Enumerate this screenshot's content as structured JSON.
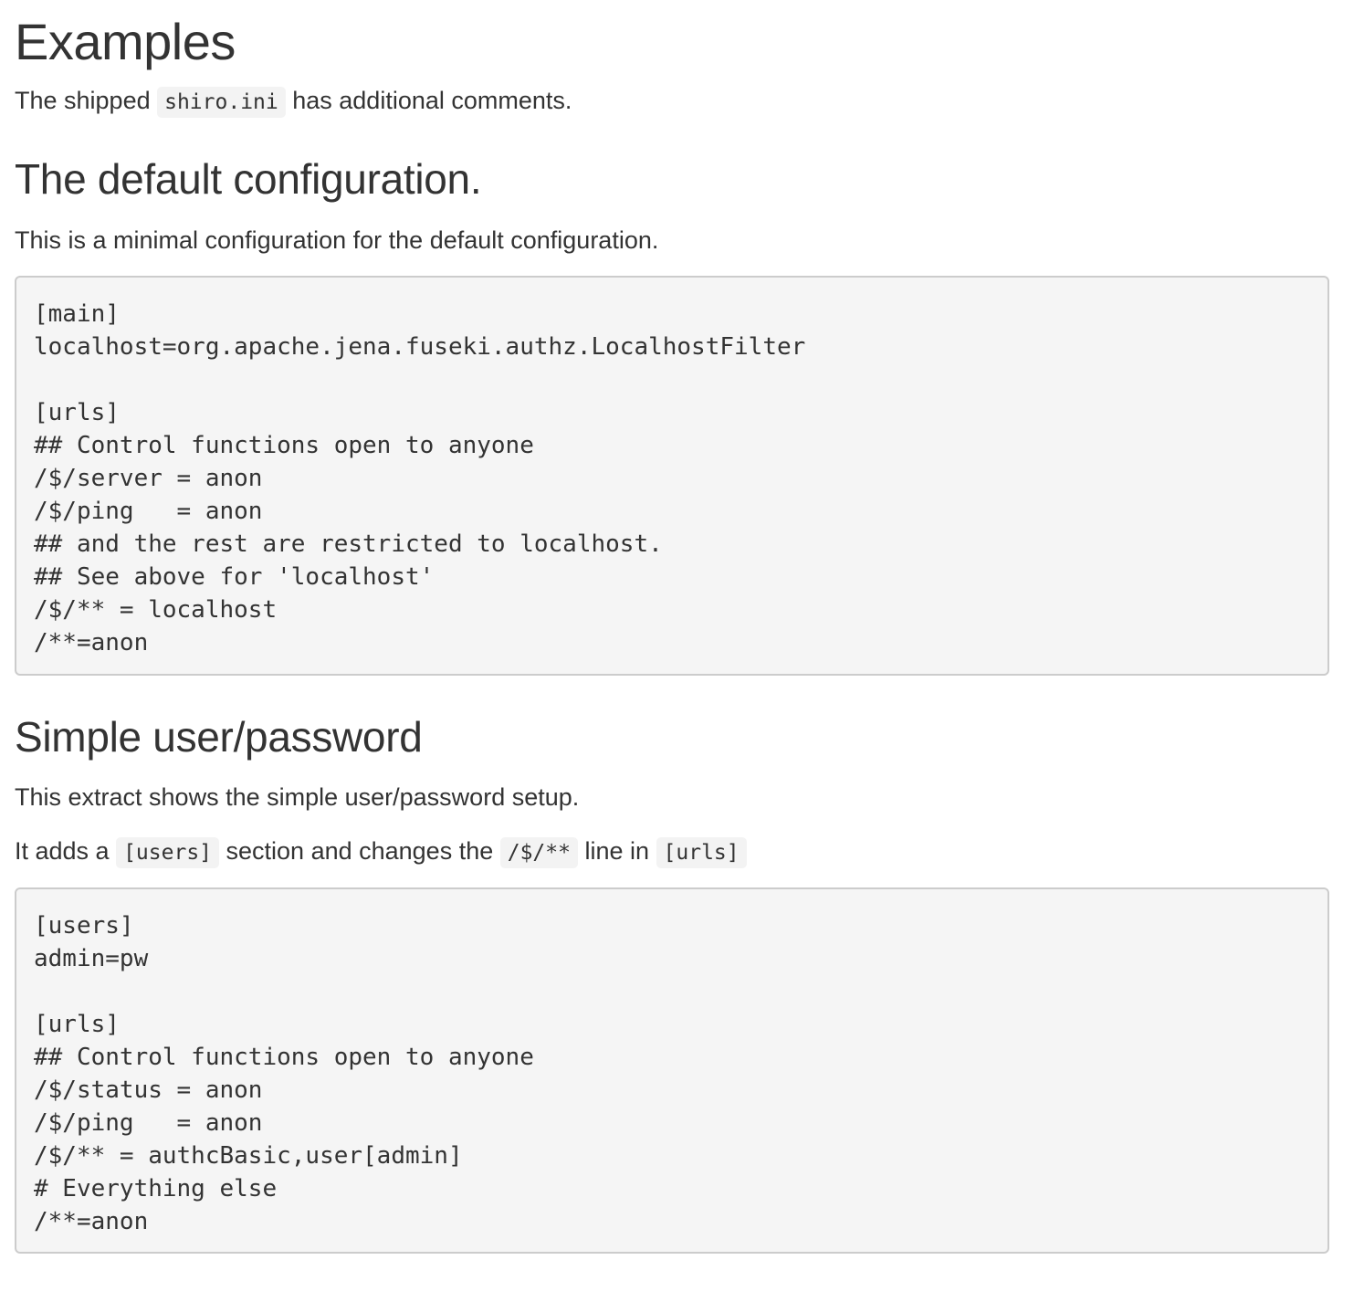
{
  "sections": {
    "examples": {
      "title": "Examples",
      "intro_prefix": "The shipped ",
      "intro_code": "shiro.ini",
      "intro_suffix": " has additional comments."
    },
    "default_config": {
      "title": "The default configuration.",
      "description": "This is a minimal configuration for the default configuration.",
      "code_lines": [
        "[main]",
        "localhost=org.apache.jena.fuseki.authz.LocalhostFilter",
        "",
        "[urls]",
        "## Control functions open to anyone",
        "/$/server = anon",
        "/$/ping   = anon",
        "## and the rest are restricted to localhost.",
        "## See above for 'localhost'",
        "/$/** = localhost",
        "/**=anon"
      ]
    },
    "simple_user": {
      "title": "Simple user/password",
      "description": "This extract shows the simple user/password setup.",
      "adds_prefix": "It adds a ",
      "adds_code1": "[users]",
      "adds_mid1": " section and changes the ",
      "adds_code2": "/$/**",
      "adds_mid2": " line in ",
      "adds_code3": "[urls]",
      "code_lines": [
        "[users]",
        "admin=pw",
        "",
        "[urls]",
        "## Control functions open to anyone",
        "/$/status = anon",
        "/$/ping   = anon",
        "/$/** = authcBasic,user[admin]",
        "# Everything else",
        "/**=anon"
      ]
    }
  }
}
